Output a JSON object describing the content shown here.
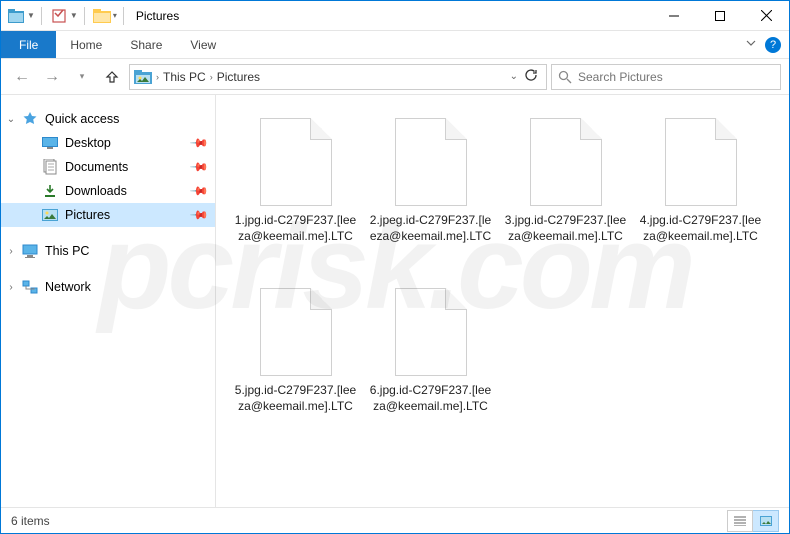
{
  "window": {
    "title": "Pictures"
  },
  "ribbon": {
    "file": "File",
    "tabs": [
      "Home",
      "Share",
      "View"
    ]
  },
  "breadcrumbs": [
    "This PC",
    "Pictures"
  ],
  "search": {
    "placeholder": "Search Pictures"
  },
  "tree": {
    "quick_access": {
      "label": "Quick access",
      "items": [
        {
          "label": "Desktop",
          "icon": "desktop"
        },
        {
          "label": "Documents",
          "icon": "documents"
        },
        {
          "label": "Downloads",
          "icon": "downloads"
        },
        {
          "label": "Pictures",
          "icon": "pictures",
          "selected": true
        }
      ]
    },
    "this_pc": {
      "label": "This PC"
    },
    "network": {
      "label": "Network"
    }
  },
  "files": [
    {
      "name": "1.jpg.id-C279F237.[leeza@keemail.me].LTC"
    },
    {
      "name": "2.jpeg.id-C279F237.[leeza@keemail.me].LTC"
    },
    {
      "name": "3.jpg.id-C279F237.[leeza@keemail.me].LTC"
    },
    {
      "name": "4.jpg.id-C279F237.[leeza@keemail.me].LTC"
    },
    {
      "name": "5.jpg.id-C279F237.[leeza@keemail.me].LTC"
    },
    {
      "name": "6.jpg.id-C279F237.[leeza@keemail.me].LTC"
    }
  ],
  "status": {
    "count_text": "6 items"
  }
}
